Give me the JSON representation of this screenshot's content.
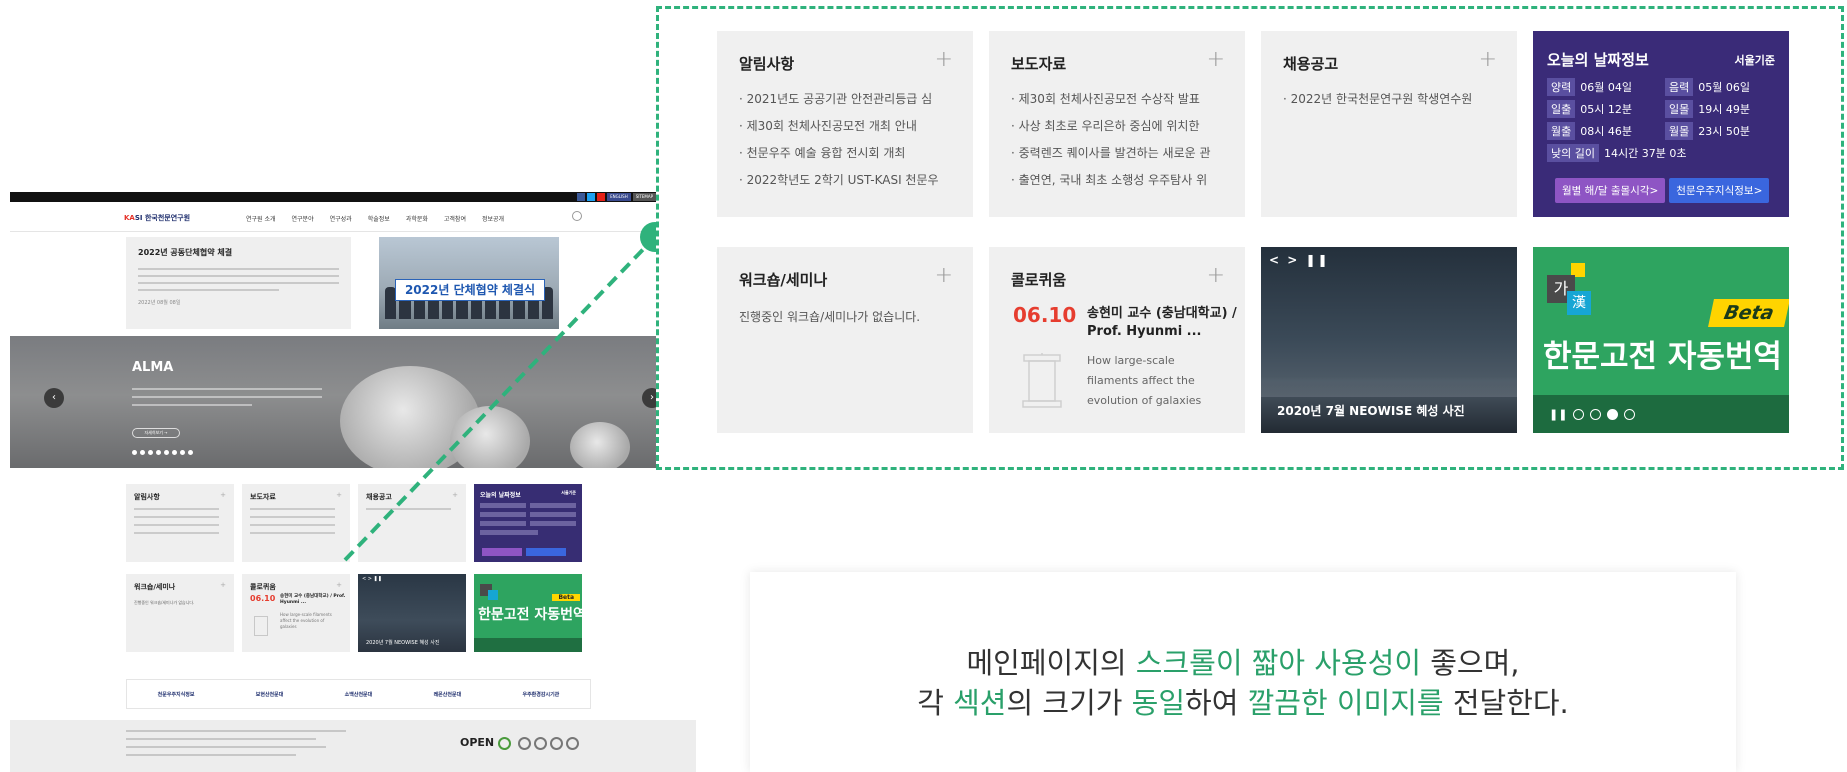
{
  "thumbnail": {
    "topbar": {
      "links": [
        "ENGLISH",
        "SITEMAP"
      ]
    },
    "logo": "한국천문연구원",
    "nav": [
      "연구원 소개",
      "연구분야",
      "연구성과",
      "학술정보",
      "과학문화",
      "고객참여",
      "정보공개"
    ],
    "notice": {
      "title": "2022년 공동단체협약 체결",
      "date": "2022년 08월 08일"
    },
    "photo_banner": "2022년 단체협약 체결식",
    "hero": {
      "title": "ALMA",
      "more": "자세히보기 →"
    },
    "cards": {
      "notice": "알림사항",
      "press": "보도자료",
      "recruit": "채용공고",
      "today": "오늘의 날짜정보",
      "today_loc": "서울기준",
      "workshop": "워크숍/세미나",
      "workshop_empty": "진행중인 워크숍/세미나가 없습니다.",
      "colloquium": "콜로퀴움",
      "colloquium_date": "06.10",
      "colloquium_speaker": "송현미 교수 (충남대학교) / Prof. Hyunmi ...",
      "colloquium_talk": "How large-scale filaments affect the evolution of galaxies",
      "photo_caption": "2020년 7월 NEOWISE 혜성 사진",
      "translate": "한문고전 자동번역",
      "beta": "Beta"
    },
    "orgs": [
      "천문우주지식정보",
      "보현산천문대",
      "소백산천문대",
      "레몬산천문대",
      "우주환경감시기관"
    ],
    "footer": {
      "open": "OPEN"
    }
  },
  "zoom": {
    "notice": {
      "title": "알림사항",
      "items": [
        "· 2021년도 공공기관 안전관리등급 심",
        "· 제30회 천체사진공모전 개최 안내",
        "· 천문우주 예술 융합 전시회 개최",
        "· 2022학년도 2학기 UST-KASI 천문우"
      ]
    },
    "press": {
      "title": "보도자료",
      "items": [
        "· 제30회 천체사진공모전 수상작 발표",
        "· 사상 최초로 우리은하 중심에 위치한",
        "· 중력렌즈 퀘이사를 발견하는 새로운 관",
        "· 출연연, 국내 최초 소행성 우주탐사 위"
      ]
    },
    "recruit": {
      "title": "채용공고",
      "items": [
        "· 2022년 한국천문연구원 학생연수원"
      ]
    },
    "today": {
      "title": "오늘의 날짜정보",
      "location": "서울기준",
      "rows": [
        {
          "label": "양력",
          "value": "06월 04일"
        },
        {
          "label": "음력",
          "value": "05월 06일"
        },
        {
          "label": "일출",
          "value": "05시 12분"
        },
        {
          "label": "일몰",
          "value": "19시 49분"
        },
        {
          "label": "월출",
          "value": "08시 46분"
        },
        {
          "label": "월몰",
          "value": "23시 50분"
        }
      ],
      "daylength_label": "낮의 길이",
      "daylength_value": "14시간 37분 0초",
      "btn_moon": "월별 해/달 출몰시각>",
      "btn_info": "천문우주지식정보>"
    },
    "workshop": {
      "title": "워크숍/세미나",
      "empty": "진행중인 워크숍/세미나가 없습니다."
    },
    "colloquium": {
      "title": "콜로퀴움",
      "date": "06.10",
      "speaker": "송현미 교수 (충남대학교) / Prof. Hyunmi ...",
      "talk": "How large-scale filaments affect the evolution of galaxies"
    },
    "photo": {
      "controls": "< > ❚❚",
      "caption": "2020년 7월 NEOWISE 혜성 사진"
    },
    "translate": {
      "ga": "가",
      "hanja": "漢",
      "beta": "Beta",
      "title": "한문고전 자동번역",
      "pause": "❚❚"
    },
    "plus": "+"
  },
  "caption": {
    "line1_a": "메인페이지의 ",
    "line1_b": "스크롤이 짧아 사용성이",
    "line1_c": " 좋으며,",
    "line2_a": "각 ",
    "line2_b": "섹션",
    "line2_c": "의 크기가 ",
    "line2_d": "동일",
    "line2_e": "하여 ",
    "line2_f": "깔끔한 이미지를",
    "line2_g": " 전달한다."
  },
  "colors": {
    "accent": "#2fb27c",
    "highlight": "#2aa06a",
    "today_bg": "#3a2b78",
    "translate_bg": "#2ea460",
    "date_red": "#e63d2f"
  }
}
